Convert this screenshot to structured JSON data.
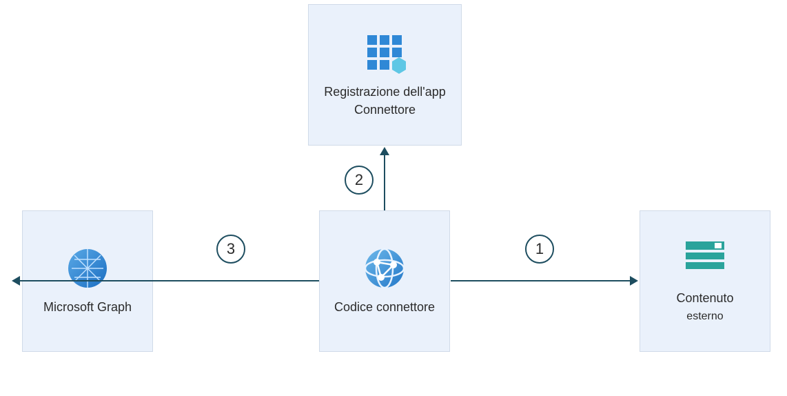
{
  "nodes": {
    "registration": {
      "label": "Registrazione dell'app Connettore"
    },
    "graph": {
      "label": "Microsoft Graph"
    },
    "connector": {
      "label": "Codice connettore"
    },
    "external": {
      "label_line1": "Contenuto",
      "label_line2": "esterno"
    }
  },
  "steps": {
    "s1": "1",
    "s2": "2",
    "s3": "3"
  },
  "colors": {
    "node_bg": "#eaf1fb",
    "arrow": "#1d4d5f",
    "accent_blue": "#2f88d6",
    "teal": "#2aa39b"
  }
}
